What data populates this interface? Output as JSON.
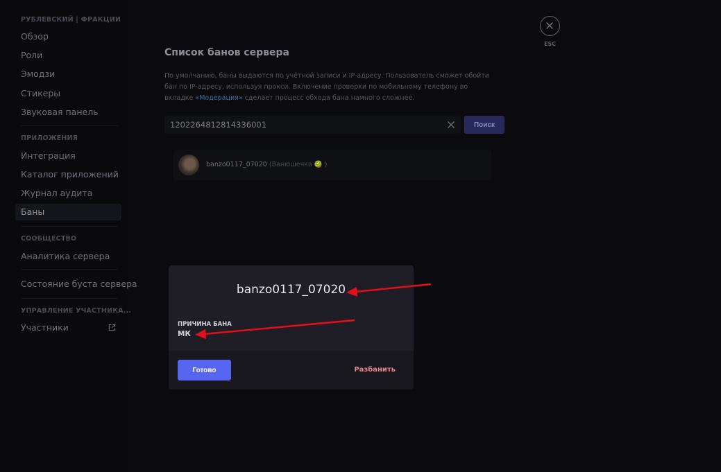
{
  "sidebar": {
    "section_server": "РУБЛЕВСКИЙ | ФРАКЦИИ",
    "items_server": [
      "Обзор",
      "Роли",
      "Эмодзи",
      "Стикеры",
      "Звуковая панель"
    ],
    "section_apps": "ПРИЛОЖЕНИЯ",
    "items_apps": [
      "Интеграция",
      "Каталог приложений",
      "Журнал аудита",
      "Баны"
    ],
    "section_community": "СООБЩЕСТВО",
    "items_community": [
      "Аналитика сервера"
    ],
    "boost_item": "Состояние буста сервера",
    "section_members": "УПРАВЛЕНИЕ УЧАСТНИКА...",
    "members_item": "Участники",
    "active_item": "Баны"
  },
  "main": {
    "title": "Список банов сервера",
    "desc_part1": "По умолчанию, баны выдаются по учётной записи и IP-адресу. Пользователь сможет обойти бан по IP-адресу, используя прокси. Включение проверки по мобильному телефону во вкладке ",
    "desc_link": "«Модерация»",
    "desc_part2": " сделает процесс обхода бана намного сложнее.",
    "search_value": "1202264812814336001",
    "search_button": "Поиск",
    "ban_username": "banzo0117_07020",
    "ban_nickname": "(Ванюшечка 🥝 )"
  },
  "close": {
    "label": "ESC"
  },
  "modal": {
    "username": "banzo0117_07020",
    "reason_label": "ПРИЧИНА БАНА",
    "reason_value": "МК",
    "done_button": "Готово",
    "unban_button": "Разбанить"
  },
  "colors": {
    "accent": "#5865f2",
    "danger": "#e7858e",
    "annotation_arrow": "#e3101a"
  },
  "icons": [
    "close-icon",
    "external-link-icon",
    "clear-icon",
    "avatar"
  ]
}
